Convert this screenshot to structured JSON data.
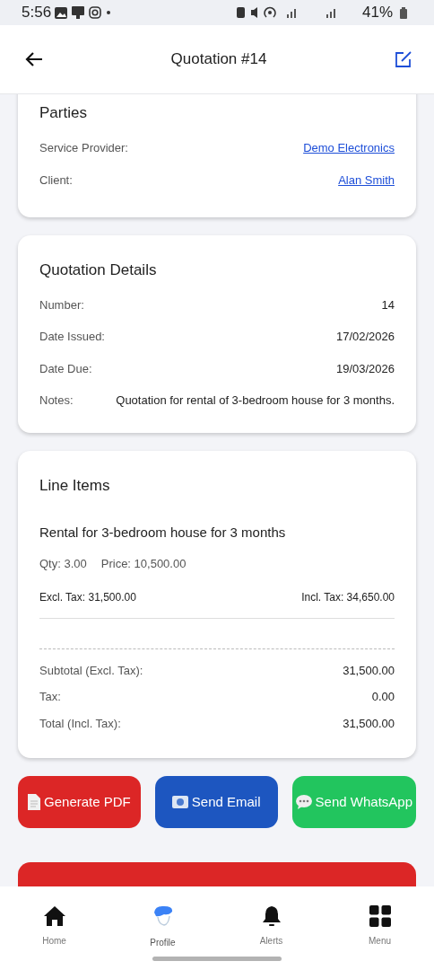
{
  "status_bar": {
    "time": "5:56",
    "battery": "41%"
  },
  "app_bar": {
    "title": "Quotation #14"
  },
  "parties": {
    "title": "Parties",
    "rows": [
      {
        "label": "Service Provider:",
        "value": "Demo Electronics"
      },
      {
        "label": "Client:",
        "value": "Alan Smith"
      }
    ]
  },
  "details": {
    "title": "Quotation Details",
    "rows": [
      {
        "label": "Number:",
        "value": "14"
      },
      {
        "label": "Date Issued:",
        "value": "17/02/2026"
      },
      {
        "label": "Date Due:",
        "value": "19/03/2026"
      },
      {
        "label": "Notes:",
        "value": "Quotation for rental of 3-bedroom house for 3 months."
      }
    ]
  },
  "line_items": {
    "title": "Line Items",
    "items": [
      {
        "description": "Rental for 3-bedroom house for 3 months",
        "qty": "Qty: 3.00",
        "price": "Price: 10,500.00",
        "excl": "Excl. Tax: 31,500.00",
        "incl": "Incl. Tax: 34,650.00"
      }
    ],
    "totals": [
      {
        "label": "Subtotal (Excl. Tax):",
        "value": "31,500.00"
      },
      {
        "label": "Tax:",
        "value": "0.00"
      },
      {
        "label": "Total (Incl. Tax):",
        "value": "31,500.00"
      }
    ]
  },
  "actions": [
    {
      "label": "Generate PDF",
      "kind": "pdf",
      "color": "#dc2626"
    },
    {
      "label": "Send Email",
      "kind": "email",
      "color": "#1d56c0"
    },
    {
      "label": "Send WhatsApp",
      "kind": "chat",
      "color": "#22c55e"
    }
  ],
  "bottom_nav": [
    {
      "label": "Home",
      "kind": "home",
      "selected": false
    },
    {
      "label": "Profile",
      "kind": "profile",
      "selected": true
    },
    {
      "label": "Alerts",
      "kind": "bell",
      "selected": false
    },
    {
      "label": "Menu",
      "kind": "grid",
      "selected": false
    }
  ]
}
